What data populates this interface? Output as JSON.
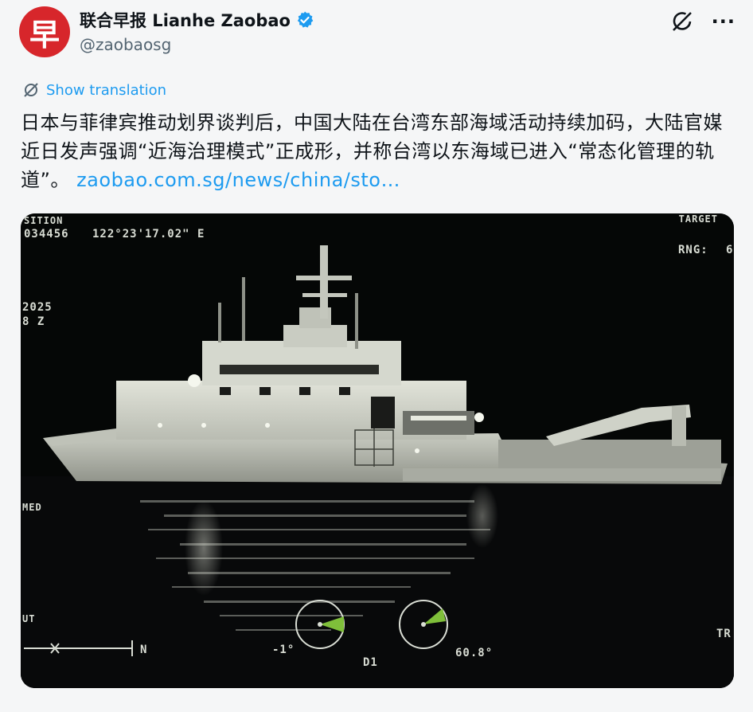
{
  "account": {
    "avatar_glyph": "早",
    "display_name": "联合早报 Lianhe Zaobao",
    "handle": "@zaobaosg",
    "verified": true,
    "brand_color": "#d7262b",
    "verified_color": "#1d9bf0"
  },
  "actions": {
    "grok_icon": "grok-icon",
    "more_label": "···"
  },
  "tweet": {
    "show_translation": "Show translation",
    "body": "日本与菲律宾推动划界谈判后，中国大陆在台湾东部海域活动持续加码，大陆官媒近日发声强调“近海治理模式”正成形，并称台湾以东海域已进入“常态化管理的轨道”。",
    "link": "zaobao.com.sg/news/china/sto…",
    "link_color": "#1d9bf0"
  },
  "media_hud": {
    "position_label": "SITION",
    "position_value": "034456",
    "longitude": "122°23'17.02\" E",
    "target_label": "TARGET",
    "rng_label": "RNG:",
    "rng_value": "6",
    "year": "2025",
    "zone": "8 Z",
    "left_label": "MED",
    "out_label": "UT",
    "tilt_value": "-1°",
    "d1_label": "D1",
    "heading_value": "60.8°",
    "n_label": "N",
    "right_label": "TR"
  }
}
